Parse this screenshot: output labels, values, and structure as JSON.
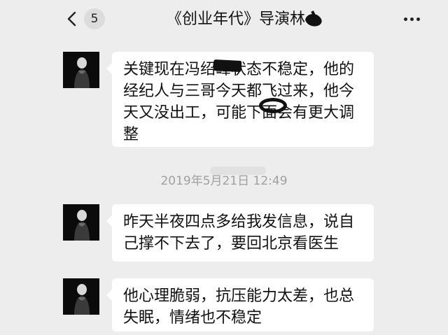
{
  "header": {
    "back_count": "5",
    "title": "《创业年代》导演林"
  },
  "messages": [
    {
      "text": "关键现在冯绍峰状态不稳定，他的经纪人与三哥今天都飞过来，他今天又没出工，可能下面会有更大调整"
    },
    {
      "text": "昨天半夜四点多给我发信息，说自己撑不下去了，要回北京看医生"
    },
    {
      "text": "他心理脆弱，抗压能力太差，也总失眠，情绪也不稳定"
    }
  ],
  "timestamp": "2019年5月21日 12:49",
  "icons": {
    "back": "chevron-left-icon",
    "more": "more-dots-icon",
    "avatar": "avatar"
  }
}
